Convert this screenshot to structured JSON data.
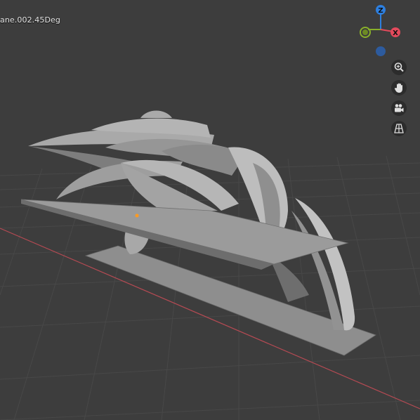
{
  "viewport": {
    "object_label": "ane.002.45Deg",
    "background_color": "#3d3d3d",
    "grid_color": "#4a4a4a",
    "x_axis_color": "#b54a53",
    "mesh_color": "#9a9a9a"
  },
  "gizmo": {
    "axes": [
      {
        "label": "Z",
        "color": "#2d7fdf"
      },
      {
        "label": "X",
        "color": "#e34a5c"
      },
      {
        "label": "",
        "color": "#89b02a"
      },
      {
        "label": "",
        "color": "#2d5b9e"
      }
    ]
  },
  "controls": [
    {
      "icon": "zoom-icon"
    },
    {
      "icon": "hand-pan-icon"
    },
    {
      "icon": "camera-icon"
    },
    {
      "icon": "grid-icon"
    }
  ]
}
